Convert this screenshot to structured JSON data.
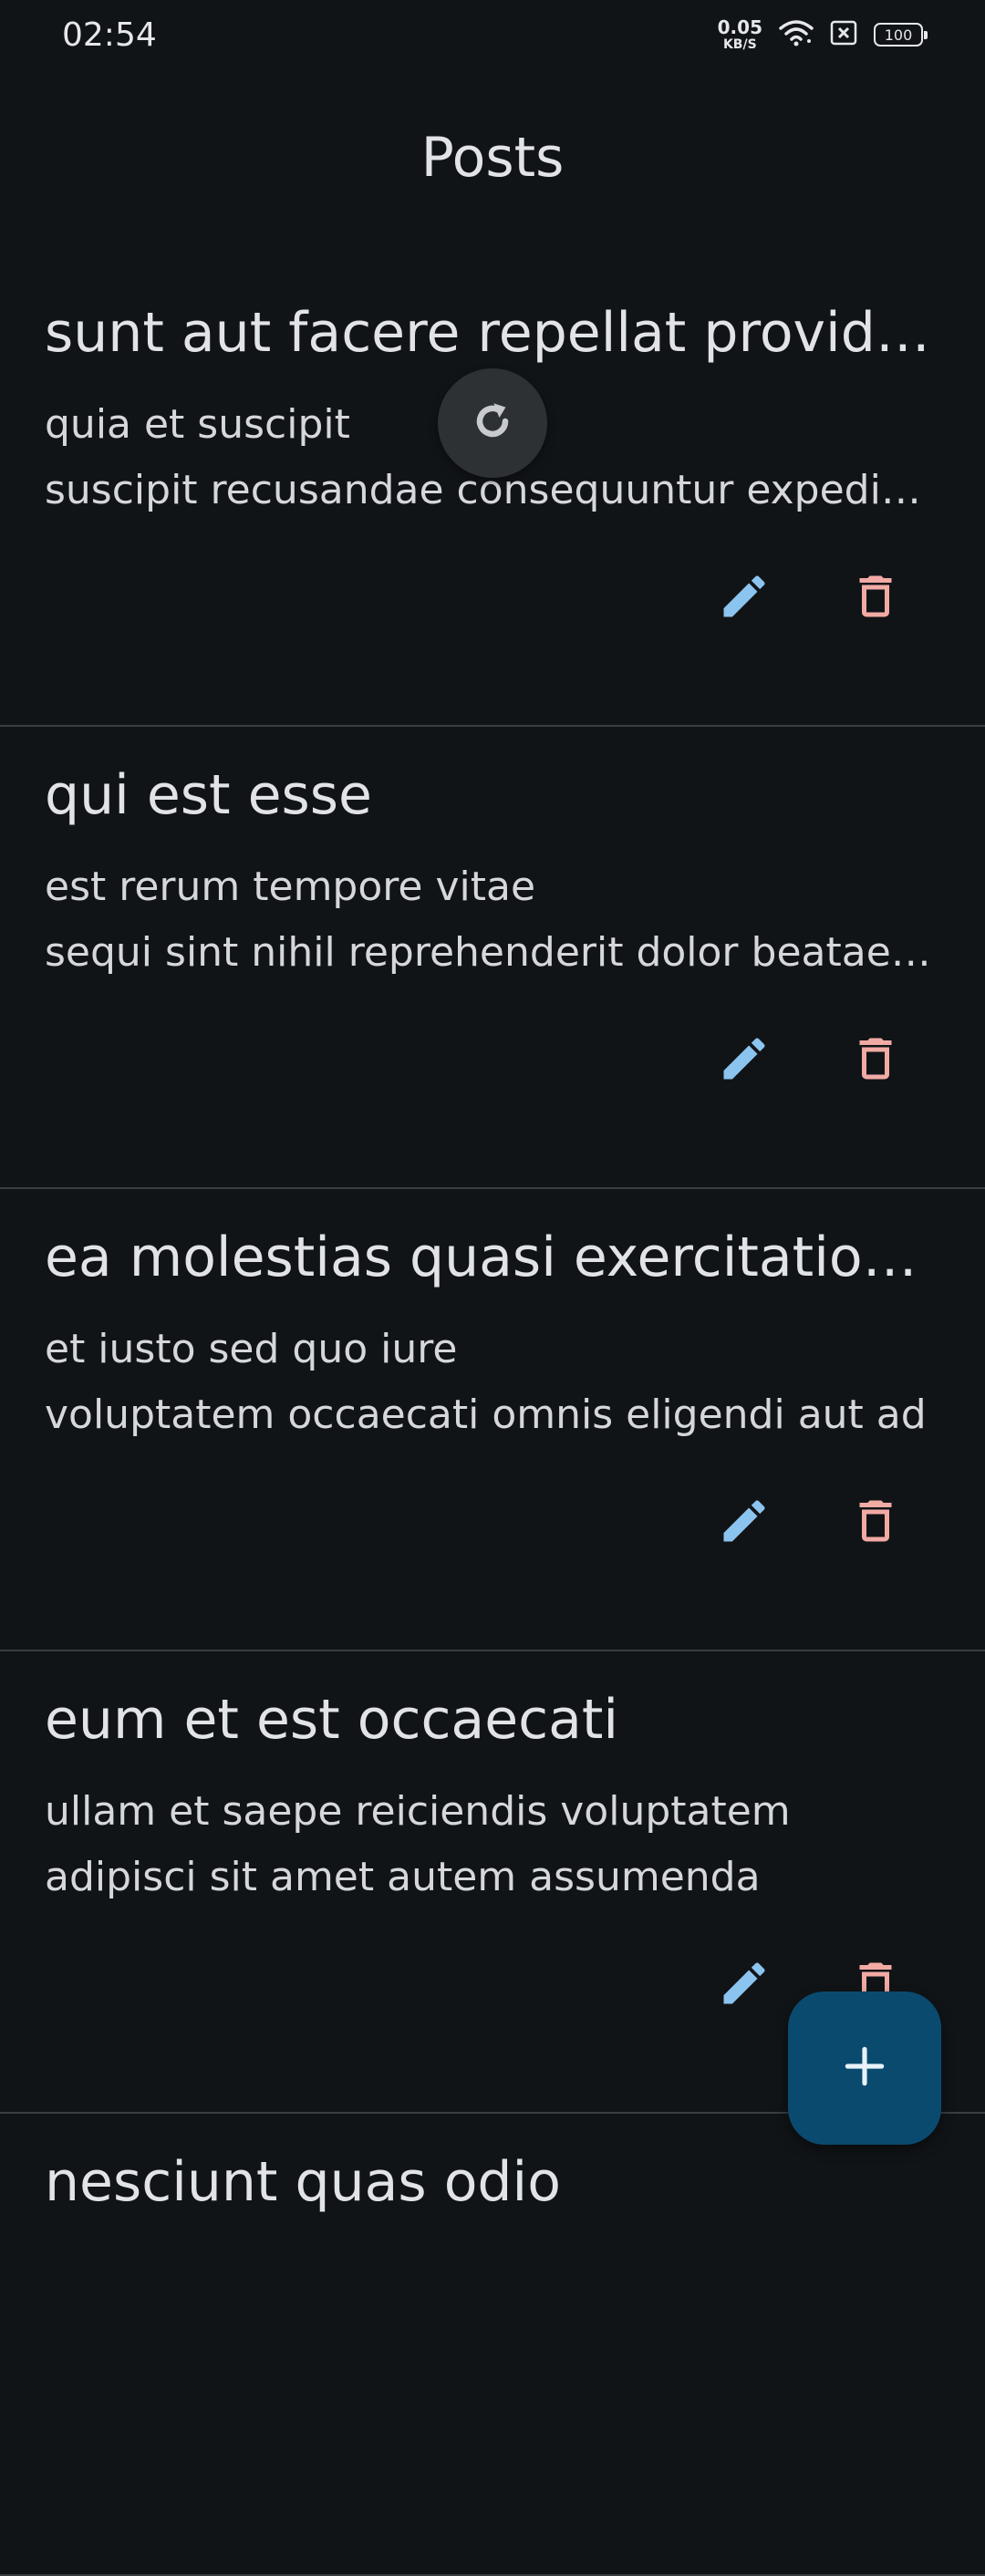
{
  "status_bar": {
    "time": "02:54",
    "net_speed_value": "0.05",
    "net_speed_unit": "KB/S",
    "battery": "100",
    "icons": [
      "wifi-icon",
      "sim-none-icon",
      "battery-icon"
    ]
  },
  "header": {
    "title": "Posts"
  },
  "posts": [
    {
      "title": "sunt aut facere repellat provident occaecati excepturi optio reprehenderit",
      "body": "quia et suscipit\nsuscipit recusandae consequuntur expedita et cum"
    },
    {
      "title": "qui est esse",
      "body": "est rerum tempore vitae\nsequi sint nihil reprehenderit dolor beatae ea dolores neque"
    },
    {
      "title": "ea molestias quasi exercitationem repellat qui ipsa sit aut",
      "body": "et iusto sed quo iure\nvoluptatem occaecati omnis eligendi aut ad"
    },
    {
      "title": "eum et est occaecati",
      "body": "ullam et saepe reiciendis voluptatem adipisci sit amet autem assumenda"
    },
    {
      "title": "nesciunt quas odio",
      "body": ""
    }
  ],
  "actions": {
    "edit_icon": "pencil-icon",
    "delete_icon": "trash-icon",
    "refresh_icon": "refresh-icon",
    "fab_icon": "plus-icon"
  },
  "colors": {
    "background": "#111417",
    "edit": "#8cc4f0",
    "delete": "#f2aaa5",
    "fab": "#0b4a6f",
    "divider": "#3a3d41"
  }
}
